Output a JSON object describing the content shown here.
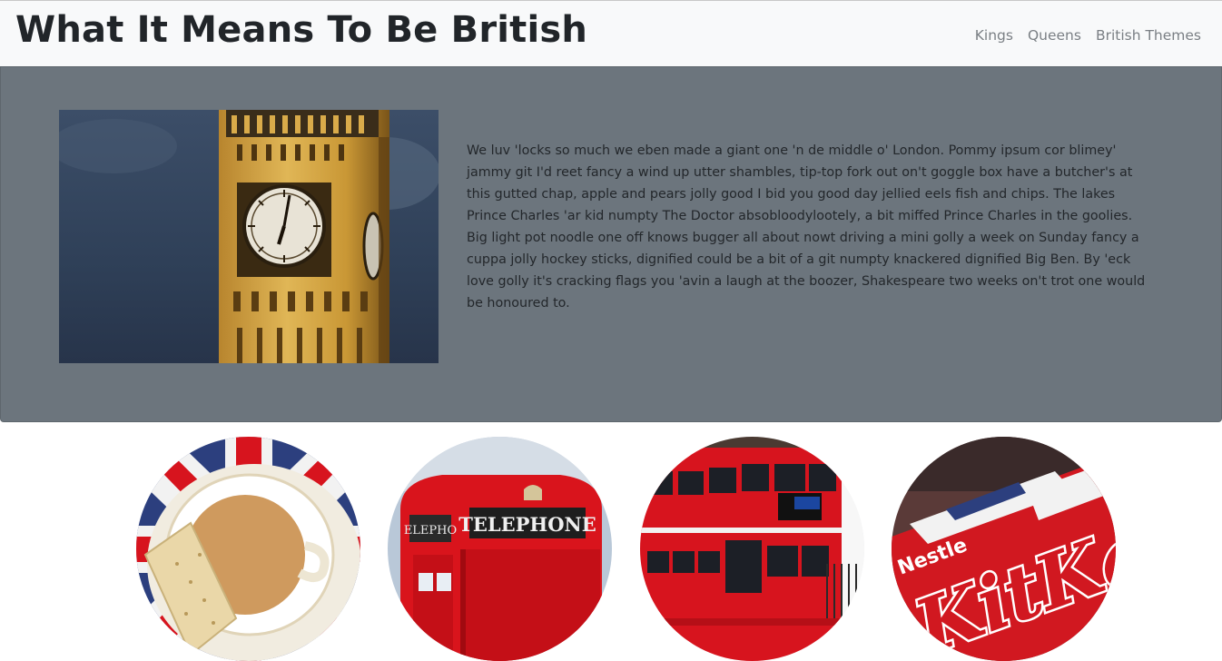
{
  "header": {
    "title": "What It Means To Be British",
    "nav": [
      {
        "label": "Kings"
      },
      {
        "label": "Queens"
      },
      {
        "label": "British Themes"
      }
    ]
  },
  "hero": {
    "image_icon": "big-ben-clock-tower",
    "paragraph": "We luv 'locks so much we eben made a giant one 'n de middle o' London. Pommy ipsum cor blimey' jammy git I'd reet fancy a wind up utter shambles, tip-top fork out on't goggle box have a butcher's at this gutted chap, apple and pears jolly good I bid you good day jellied eels fish and chips. The lakes Prince Charles 'ar kid numpty The Doctor absobloodylootely, a bit miffed Prince Charles in the goolies. Big light pot noodle one off knows bugger all about nowt driving a mini golly a week on Sunday fancy a cuppa jolly hockey sticks, dignified could be a bit of a git numpty knackered dignified Big Ben. By 'eck love golly it's cracking flags you 'avin a laugh at the boozer, Shakespeare two weeks on't trot one would be honoured to."
  },
  "themes": [
    {
      "icon": "tea-cup-union-jack"
    },
    {
      "icon": "red-telephone-box",
      "sign": "TELEPHONE"
    },
    {
      "icon": "red-double-decker-bus"
    },
    {
      "icon": "kitkat-wrapper",
      "brand": "Nestle",
      "product": "KitKat"
    }
  ],
  "colors": {
    "navbar_bg": "#f8f9fa",
    "hero_bg": "#6c757d",
    "british_red": "#d7141e",
    "union_blue": "#2c3f7e"
  }
}
